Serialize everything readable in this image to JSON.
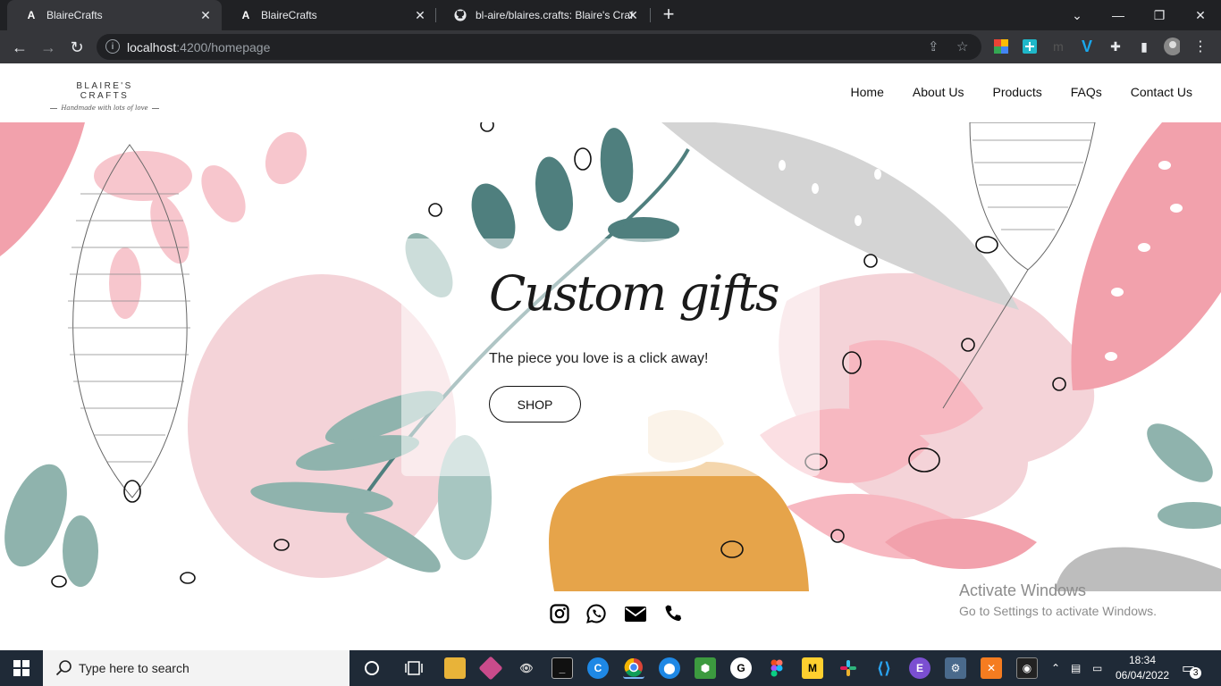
{
  "browser": {
    "tabs": [
      {
        "title": "BlaireCrafts",
        "favicon": "angular-icon",
        "active": true
      },
      {
        "title": "BlaireCrafts",
        "favicon": "angular-icon",
        "active": false
      },
      {
        "title": "bl-aire/blaires.crafts: Blaire's Craf",
        "favicon": "github-icon",
        "active": false
      }
    ],
    "url_host": "localhost",
    "url_path": ":4200/homepage"
  },
  "site": {
    "logo_title": "BLAIRE'S CRAFTS",
    "logo_tagline": "Handmade with lots of love",
    "nav": [
      "Home",
      "About Us",
      "Products",
      "FAQs",
      "Contact Us"
    ],
    "hero": {
      "title": "Custom gifts",
      "subtitle": "The piece you love is a click away!",
      "button": "SHOP"
    },
    "social": [
      "instagram-icon",
      "whatsapp-icon",
      "mail-icon",
      "phone-icon"
    ]
  },
  "activation": {
    "line1": "Activate Windows",
    "line2": "Go to Settings to activate Windows."
  },
  "taskbar": {
    "search_placeholder": "Type here to search",
    "time": "18:34",
    "date": "06/04/2022",
    "notifications": "3"
  },
  "colors": {
    "pink": "#f2a1ac",
    "teal": "#4f7f7e",
    "sage": "#8fb3ad",
    "mustard": "#e6a44a",
    "grey": "#c9c9c9"
  }
}
